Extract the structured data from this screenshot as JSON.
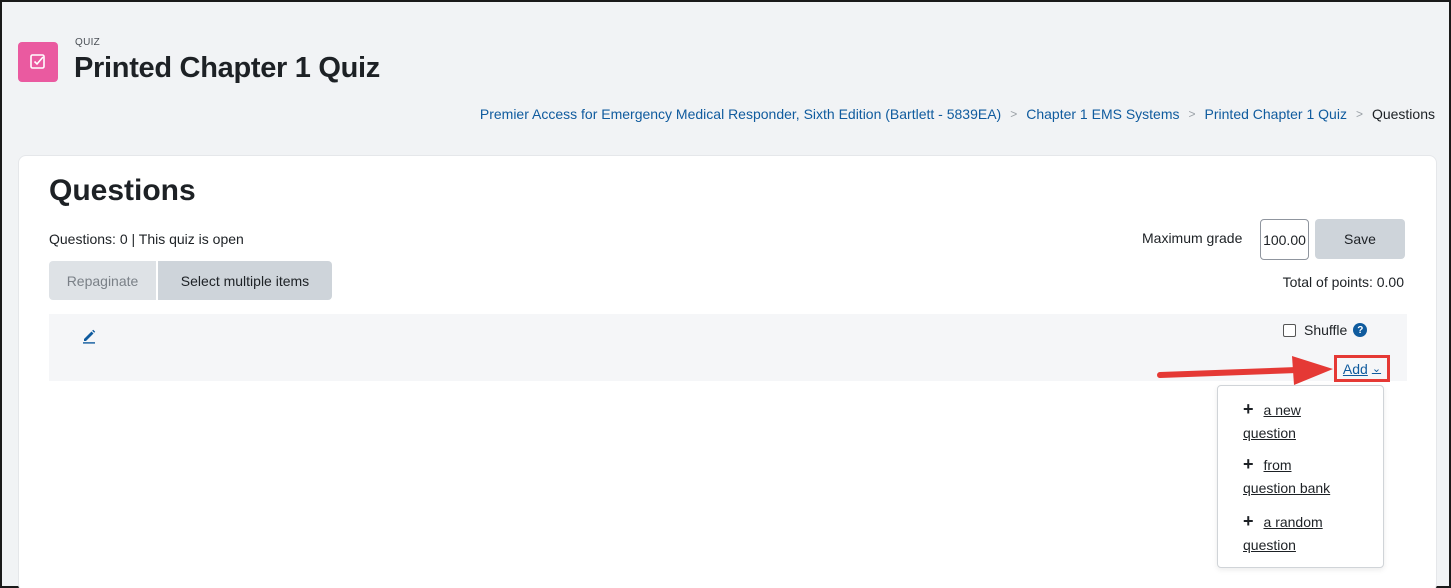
{
  "header": {
    "module_label": "QUIZ",
    "title": "Printed Chapter 1 Quiz",
    "icon_color": "#ea5aa0",
    "breadcrumb": [
      "Premier Access for Emergency Medical Responder, Sixth Edition (Bartlett - 5839EA)",
      "Chapter 1 EMS Systems",
      "Printed Chapter 1 Quiz",
      "Questions"
    ]
  },
  "main": {
    "heading": "Questions",
    "status": "Questions: 0 | This quiz is open",
    "repaginate_label": "Repaginate",
    "select_multiple_label": "Select multiple items",
    "max_grade_label": "Maximum grade",
    "max_grade_value": "100.00",
    "save_label": "Save",
    "total_points": "Total of points: 0.00",
    "shuffle_label": "Shuffle",
    "shuffle_checked": false,
    "add_label": "Add",
    "add_menu": [
      {
        "prefix": "a new",
        "suffix": "question"
      },
      {
        "prefix": "from",
        "suffix": "question bank"
      },
      {
        "prefix": "a random",
        "suffix": "question"
      }
    ]
  },
  "annotation": {
    "arrow_color": "#e53935"
  }
}
